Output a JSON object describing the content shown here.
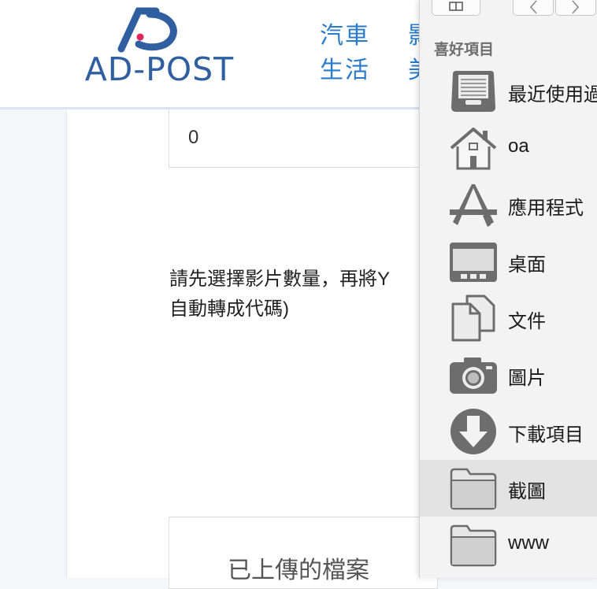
{
  "site": {
    "logo_text": "AD-POST",
    "nav": [
      {
        "label": "汽車"
      },
      {
        "label": "生活"
      },
      {
        "label": "影"
      },
      {
        "label": "美"
      }
    ]
  },
  "form": {
    "count_value": "0",
    "instruction_line1": "請先選擇影片數量，再將Y",
    "instruction_line2": "自動轉成代碼)",
    "uploaded_title": "已上傳的檔案"
  },
  "finder": {
    "section_title": "喜好項目",
    "items": [
      {
        "label": "最近使用過",
        "icon": "recents-tray-icon"
      },
      {
        "label": "oa",
        "icon": "home-icon"
      },
      {
        "label": "應用程式",
        "icon": "applications-icon"
      },
      {
        "label": "桌面",
        "icon": "desktop-icon"
      },
      {
        "label": "文件",
        "icon": "documents-icon"
      },
      {
        "label": "圖片",
        "icon": "camera-icon"
      },
      {
        "label": "下載項目",
        "icon": "download-icon"
      },
      {
        "label": "截圖",
        "icon": "folder-icon",
        "selected": true
      },
      {
        "label": "www",
        "icon": "folder-icon"
      }
    ]
  }
}
